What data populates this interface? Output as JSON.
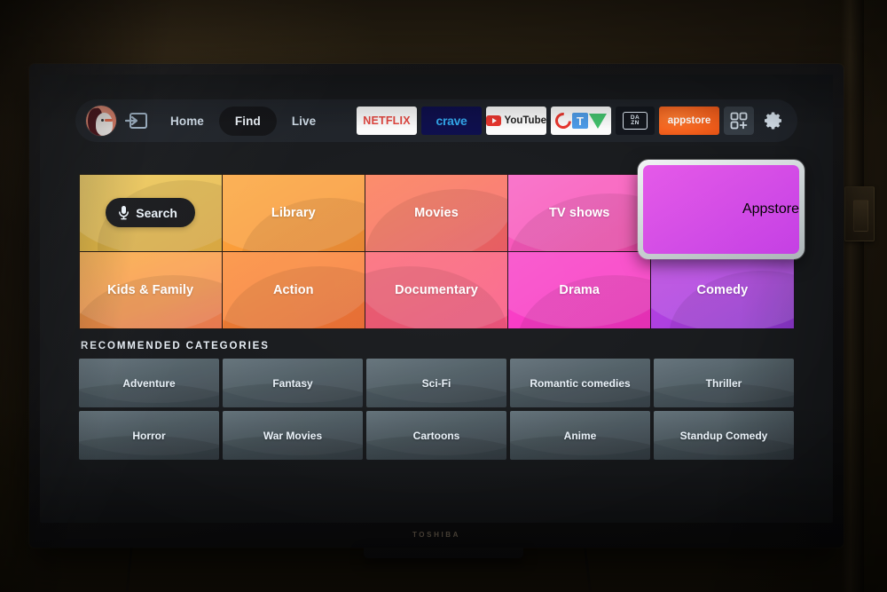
{
  "device": {
    "brand": "TOSHIBA"
  },
  "topbar": {
    "avatar_alt": "user-avatar",
    "signin_label": "sign-in",
    "nav": [
      {
        "label": "Home",
        "selected": false
      },
      {
        "label": "Find",
        "selected": true
      },
      {
        "label": "Live",
        "selected": false
      }
    ],
    "apps": [
      {
        "name": "netflix",
        "label": "NETFLIX"
      },
      {
        "name": "crave",
        "label": "crave"
      },
      {
        "name": "youtube",
        "label": "YouTube"
      },
      {
        "name": "ctv",
        "label": "CTV"
      },
      {
        "name": "dazn",
        "label_top": "DA",
        "label_bottom": "ZN"
      },
      {
        "name": "appstore",
        "label": "appstore"
      }
    ],
    "add_apps_label": "add-apps",
    "settings_label": "settings"
  },
  "main_grid": {
    "row1": [
      {
        "label": "Search",
        "has_search_pill": true
      },
      {
        "label": "Library"
      },
      {
        "label": "Movies"
      },
      {
        "label": "TV shows"
      },
      {
        "label": "Appstore",
        "focused": true
      }
    ],
    "row2": [
      {
        "label": "Kids & Family"
      },
      {
        "label": "Action"
      },
      {
        "label": "Documentary"
      },
      {
        "label": "Drama"
      },
      {
        "label": "Comedy"
      }
    ]
  },
  "recommended": {
    "title": "RECOMMENDED CATEGORIES",
    "row1": [
      "Adventure",
      "Fantasy",
      "Sci-Fi",
      "Romantic comedies",
      "Thriller"
    ],
    "row2": [
      "Horror",
      "War Movies",
      "Cartoons",
      "Anime",
      "Standup Comedy"
    ]
  },
  "colors": {
    "screen_bg": "#16181b",
    "topbar_bg": "#1d2127",
    "selected_pill": "#101114",
    "text_primary": "#e9f1f8",
    "focus_border": "#dfe5e8",
    "tile_search": "#ecc54d",
    "tile_library": "#fba53a",
    "tile_movies": "#fb7a52",
    "tile_tvshows": "#f95fc2",
    "tile_appstore": "#d24ae6",
    "tile_kids": "#f9a93c",
    "tile_action": "#fb8b33",
    "tile_documentary": "#fb6470",
    "tile_drama": "#f93fc6",
    "tile_comedy": "#ab3ce0",
    "rec_tile": "#4a5860",
    "appstore_accent": "#f4601b"
  }
}
